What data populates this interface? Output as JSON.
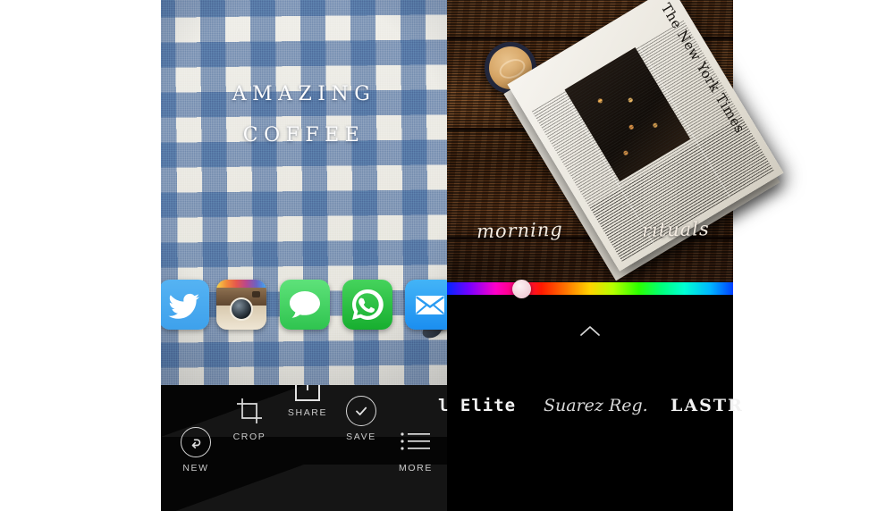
{
  "app": {
    "name": "photo-text-editor",
    "left_screen": "photo-with-text-overlay-and-share-sheet",
    "right_screen": "font-and-color-picker"
  },
  "left_panel": {
    "photo": {
      "subject": "overhead latte on blue gingham tablecloth",
      "background_color": "#e9e7e0",
      "accent_color": "#3a6098"
    },
    "overlay_text": {
      "line1": "AMAZING",
      "line2": "COFFEE",
      "color": "#fdfdfd"
    },
    "share_apps": [
      {
        "id": "twitter",
        "label": "Twitter",
        "icon": "twitter-bird-icon",
        "color": "#4aa9ed"
      },
      {
        "id": "instagram",
        "label": "Instagram",
        "icon": "instagram-camera-icon",
        "color": "#a78968"
      },
      {
        "id": "messages",
        "label": "Messages",
        "icon": "message-bubble-icon",
        "color": "#2fc44f"
      },
      {
        "id": "whatsapp",
        "label": "WhatsApp",
        "icon": "whatsapp-phone-bubble-icon",
        "color": "#17ae2f"
      },
      {
        "id": "mail",
        "label": "Mail",
        "icon": "envelope-icon",
        "color": "#1b8ef0"
      }
    ],
    "toolbar": {
      "background_color": "#050505",
      "items": [
        {
          "id": "new",
          "label": "NEW",
          "icon": "undo-arrow-circle-icon"
        },
        {
          "id": "crop",
          "label": "CROP",
          "icon": "crop-icon"
        },
        {
          "id": "share",
          "label": "SHARE",
          "icon": "share-upload-icon"
        },
        {
          "id": "save",
          "label": "SAVE",
          "icon": "checkmark-circle-icon"
        },
        {
          "id": "more",
          "label": "MORE",
          "icon": "list-bullets-icon"
        }
      ]
    }
  },
  "right_panel": {
    "photo": {
      "subject": "folded newspaper and coffee mug on dark wood table",
      "background_color": "#4b2d18"
    },
    "newspaper": {
      "masthead": "The New York Times"
    },
    "overlay_text": {
      "left": "morning",
      "right": "rituals",
      "color": "#f4ece2"
    },
    "color_slider": {
      "name": "hue-slider",
      "handle_position_percent": 26,
      "selected_color": "#f0cfd8",
      "gradient": "rainbow-hue"
    },
    "expand_control": {
      "icon": "chevron-up-icon"
    },
    "font_picker": {
      "fonts": [
        {
          "id": "special-elite",
          "label": "l Elite",
          "style": "typewriter",
          "truncated": true
        },
        {
          "id": "suarez-reg",
          "label": "Suarez Reg.",
          "style": "script",
          "truncated": false
        },
        {
          "id": "lastr",
          "label": "LASTR",
          "style": "slab-serif",
          "truncated": true
        }
      ]
    }
  }
}
